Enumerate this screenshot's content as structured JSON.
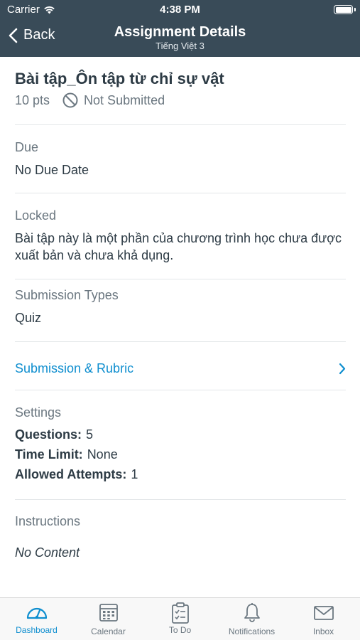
{
  "status_bar": {
    "carrier": "Carrier",
    "time": "4:38 PM"
  },
  "nav": {
    "back_label": "Back",
    "title": "Assignment Details",
    "subtitle": "Tiếng Việt 3"
  },
  "assignment": {
    "title": "Bài tập_Ôn tập từ chỉ sự vật",
    "points": "10 pts",
    "status": "Not Submitted"
  },
  "due": {
    "label": "Due",
    "value": "No Due Date"
  },
  "locked": {
    "label": "Locked",
    "value": "Bài tập này là một phần của chương trình học chưa được xuất bản và chưa khả dụng."
  },
  "submission_types": {
    "label": "Submission Types",
    "value": "Quiz"
  },
  "submission_rubric": {
    "label": "Submission & Rubric"
  },
  "settings": {
    "label": "Settings",
    "questions_label": "Questions:",
    "questions_value": "5",
    "time_limit_label": "Time Limit:",
    "time_limit_value": "None",
    "attempts_label": "Allowed Attempts:",
    "attempts_value": "1"
  },
  "instructions": {
    "label": "Instructions",
    "value": "No Content"
  },
  "tabbar": {
    "active": "Dashboard",
    "items": [
      {
        "label": "Dashboard",
        "icon": "dashboard-icon"
      },
      {
        "label": "Calendar",
        "icon": "calendar-icon"
      },
      {
        "label": "To Do",
        "icon": "todo-icon"
      },
      {
        "label": "Notifications",
        "icon": "bell-icon"
      },
      {
        "label": "Inbox",
        "icon": "inbox-icon"
      }
    ]
  },
  "colors": {
    "header": "#394b58",
    "accent": "#0e8ecf",
    "text": "#2d3b45",
    "muted": "#6b7780"
  }
}
